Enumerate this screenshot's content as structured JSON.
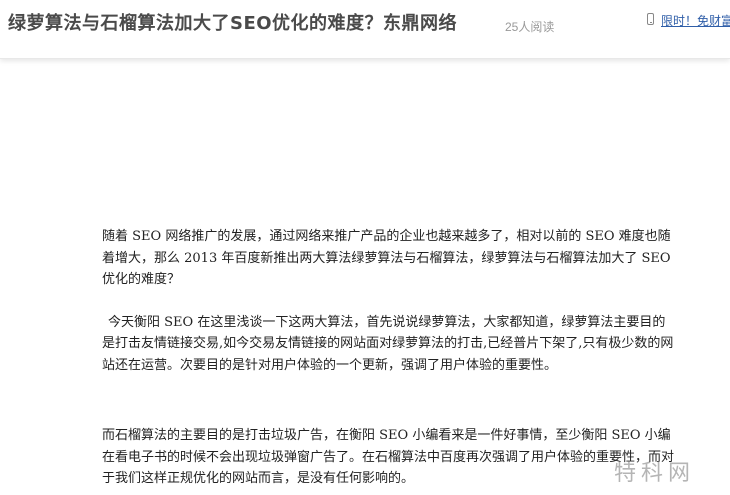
{
  "header": {
    "title": "绿萝算法与石榴算法加大了SEO优化的难度？东鼎网络",
    "read_count": "25人阅读",
    "promo_text": "限时！免财富"
  },
  "article": {
    "paragraphs": [
      "随着 SEO 网络推广的发展，通过网络来推广产品的企业也越来越多了，相对以前的 SEO 难度也随着增大，那么 2013 年百度新推出两大算法绿萝算法与石榴算法，绿萝算法与石榴算法加大了 SEO 优化的难度？",
      "今天衡阳 SEO 在这里浅谈一下这两大算法，首先说说绿萝算法，大家都知道，绿萝算法主要目的是打击友情链接交易,如今交易友情链接的网站面对绿萝算法的打击,已经普片下架了,只有极少数的网站还在运营。次要目的是针对用户体验的一个更新，强调了用户体验的重要性。",
      "而石榴算法的主要目的是打击垃圾广告，在衡阳 SEO 小编看来是一件好事情，至少衡阳 SEO 小编在看电子书的时候不会出现垃圾弹窗广告了。在石榴算法中百度再次强调了用户体验的重要性，而对于我们这样正规优化的网站而言，是没有任何影响的。"
    ]
  },
  "watermark": {
    "text": "特科网"
  }
}
